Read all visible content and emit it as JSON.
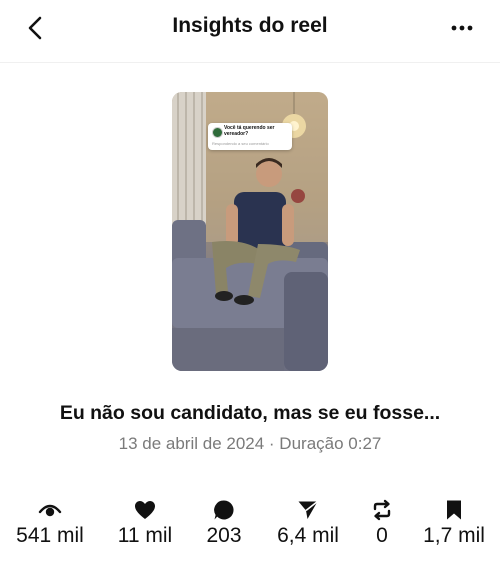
{
  "header": {
    "title": "Insights do reel",
    "back_icon": "chevron-left-icon",
    "more_icon": "more-horizontal-icon"
  },
  "reel": {
    "sticker_question": "Você tá querendo ser vereador?",
    "sticker_response": "Respondendo a seu comentário",
    "caption": "Eu não sou candidato, mas se eu fosse...",
    "date": "13 de abril de 2024",
    "duration_label": "Duração 0:27",
    "meta_separator": " · "
  },
  "stats": [
    {
      "icon": "eye-icon",
      "value": "541 mil"
    },
    {
      "icon": "heart-icon",
      "value": "11 mil"
    },
    {
      "icon": "comment-icon",
      "value": "203"
    },
    {
      "icon": "send-icon",
      "value": "6,4 mil"
    },
    {
      "icon": "repost-icon",
      "value": "0"
    },
    {
      "icon": "bookmark-icon",
      "value": "1,7 mil"
    }
  ]
}
